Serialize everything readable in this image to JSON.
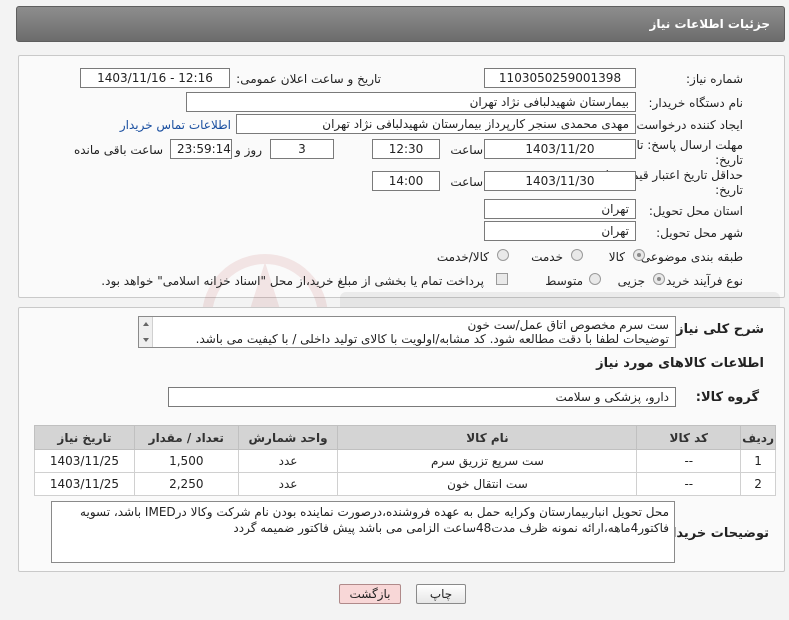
{
  "header": {
    "title": "جزئیات اطلاعات نیاز"
  },
  "form": {
    "need_number_label": "شماره نیاز:",
    "need_number": "1103050259001398",
    "announce_label": "تاریخ و ساعت اعلان عمومی:",
    "announce_value": "1403/11/16 - 12:16",
    "buyer_org_label": "نام دستگاه خریدار:",
    "buyer_org": "بیمارستان شهیدلبافی نژاد تهران",
    "requester_label": "ایجاد کننده درخواست:",
    "requester": "مهدی محمدی سنجر کارپرداز بیمارستان شهیدلبافی نژاد تهران",
    "contact_link": "اطلاعات تماس خریدار",
    "reply_deadline_label_1": "مهلت ارسال پاسخ: تا",
    "reply_deadline_label_2": "تاریخ:",
    "reply_date": "1403/11/20",
    "time_label": "ساعت",
    "reply_time": "12:30",
    "days_value": "3",
    "days_label": "روز و",
    "remaining_time": "23:59:14",
    "remaining_label": "ساعت باقی مانده",
    "price_validity_label_1": "حداقل تاریخ اعتبار قیمت: تا",
    "price_validity_label_2": "تاریخ:",
    "validity_date": "1403/11/30",
    "validity_time": "14:00",
    "province_label": "استان محل تحویل:",
    "province": "تهران",
    "city_label": "شهر محل تحویل:",
    "city": "تهران",
    "category_label": "طبقه بندی موضوعی:",
    "category_options": [
      "کالا",
      "خدمت",
      "کالا/خدمت"
    ],
    "process_label": "نوع فرآیند خرید :",
    "process_options": [
      "جزیی",
      "متوسط"
    ],
    "payment_note": "پرداخت تمام یا بخشی از مبلغ خرید،از محل \"اسناد خزانه اسلامی\" خواهد بود."
  },
  "description": {
    "label": "شرح کلی نیاز:",
    "line1": "ست سرم مخصوص اتاق عمل/ست خون",
    "line2": "توضیحات لطفا با دقت مطالعه شود. کد مشابه/اولویت با کالای تولید داخلی / با کیفیت می باشد."
  },
  "goods": {
    "section_title": "اطلاعات کالاهای مورد نیاز",
    "group_label": "گروه کالا:",
    "group_value": "دارو، پزشکی و سلامت",
    "columns": [
      "ردیف",
      "کد کالا",
      "نام کالا",
      "واحد شمارش",
      "تعداد / مقدار",
      "تاریخ نیاز"
    ],
    "rows": [
      [
        "1",
        "--",
        "ست سرپع تزریق سرم",
        "عدد",
        "1,500",
        "1403/11/25"
      ],
      [
        "2",
        "--",
        "ست انتقال خون",
        "عدد",
        "2,250",
        "1403/11/25"
      ]
    ]
  },
  "buyer_notes": {
    "label": "توضیحات خریدار:",
    "text": "محل تحویل انباربیمارستان وکرایه حمل به عهده فروشنده،درصورت نماینده بودن نام شرکت وکالا درIMED باشد، تسویه فاکتور4ماهه،ارائه نمونه ظرف مدت48ساعت الزامی می باشد پیش فاکتور ضمیمه گردد"
  },
  "buttons": {
    "print": "چاپ",
    "back": "بازگشت"
  },
  "colors": {
    "link": "#1a4fa0",
    "header_bg": "#7b7b7b",
    "back_button_bg": "#f8d7d7"
  }
}
